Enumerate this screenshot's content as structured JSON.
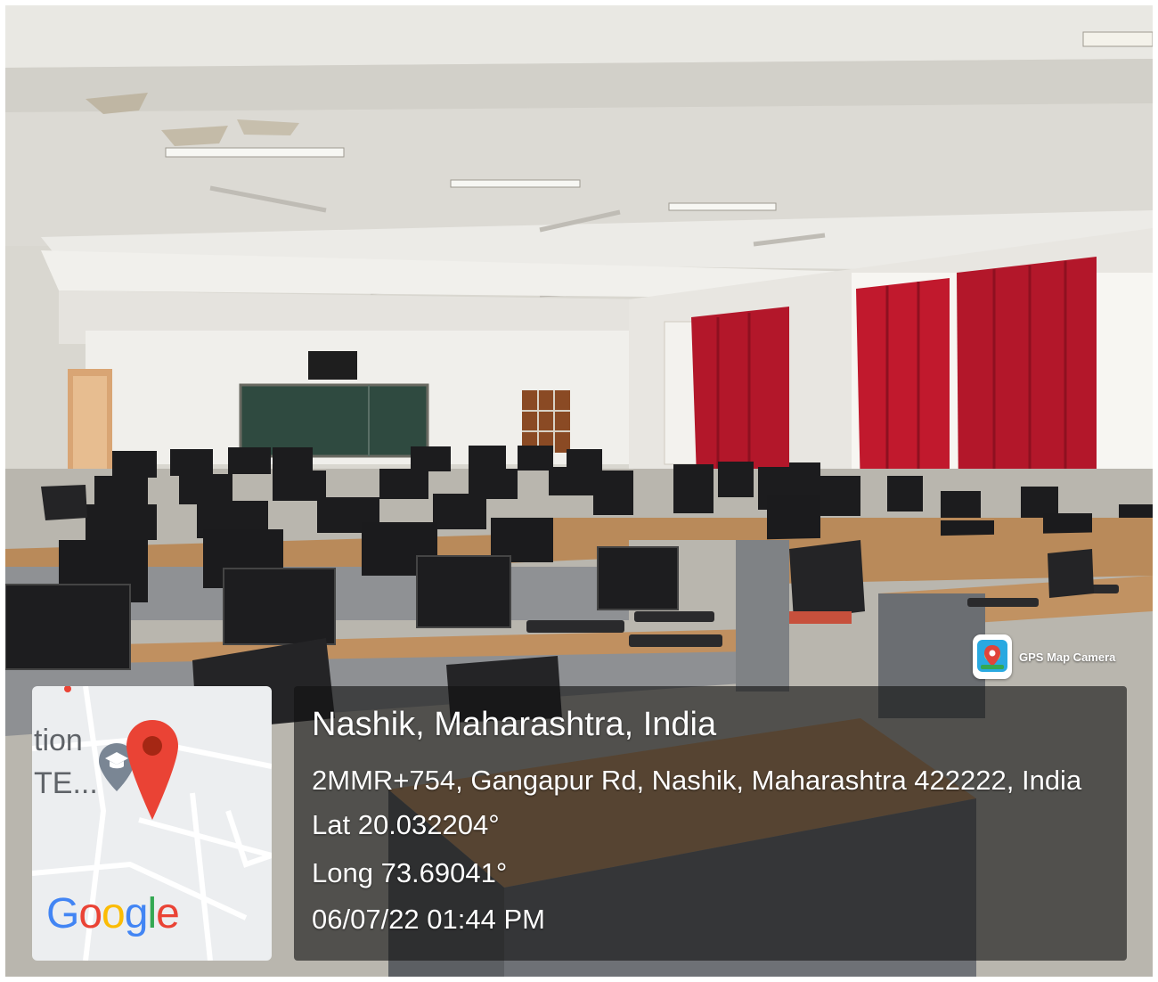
{
  "overlay": {
    "badge_label": "GPS Map Camera",
    "map": {
      "partial_label_1": "tion",
      "partial_label_2": "TE...",
      "logo_letters": [
        "G",
        "o",
        "o",
        "g",
        "l",
        "e"
      ],
      "logo_colors": [
        "#4285F4",
        "#EA4335",
        "#FBBC05",
        "#4285F4",
        "#34A853",
        "#EA4335"
      ],
      "pin_color": "#EA4335",
      "place_icon": "graduation-cap-pin-icon"
    },
    "location_title": "Nashik, Maharashtra, India",
    "address": "2MMR+754, Gangapur Rd, Nashik, Maharashtra 422222, India",
    "latitude": "Lat 20.032204°",
    "longitude": "Long 73.69041°",
    "datetime": "06/07/22 01:44 PM"
  },
  "scene": {
    "description_colors": {
      "curtains": "#b3172a",
      "blackboard": "#2f4a40",
      "desks": "#b98a5a",
      "walls": "#e6e4df"
    }
  }
}
